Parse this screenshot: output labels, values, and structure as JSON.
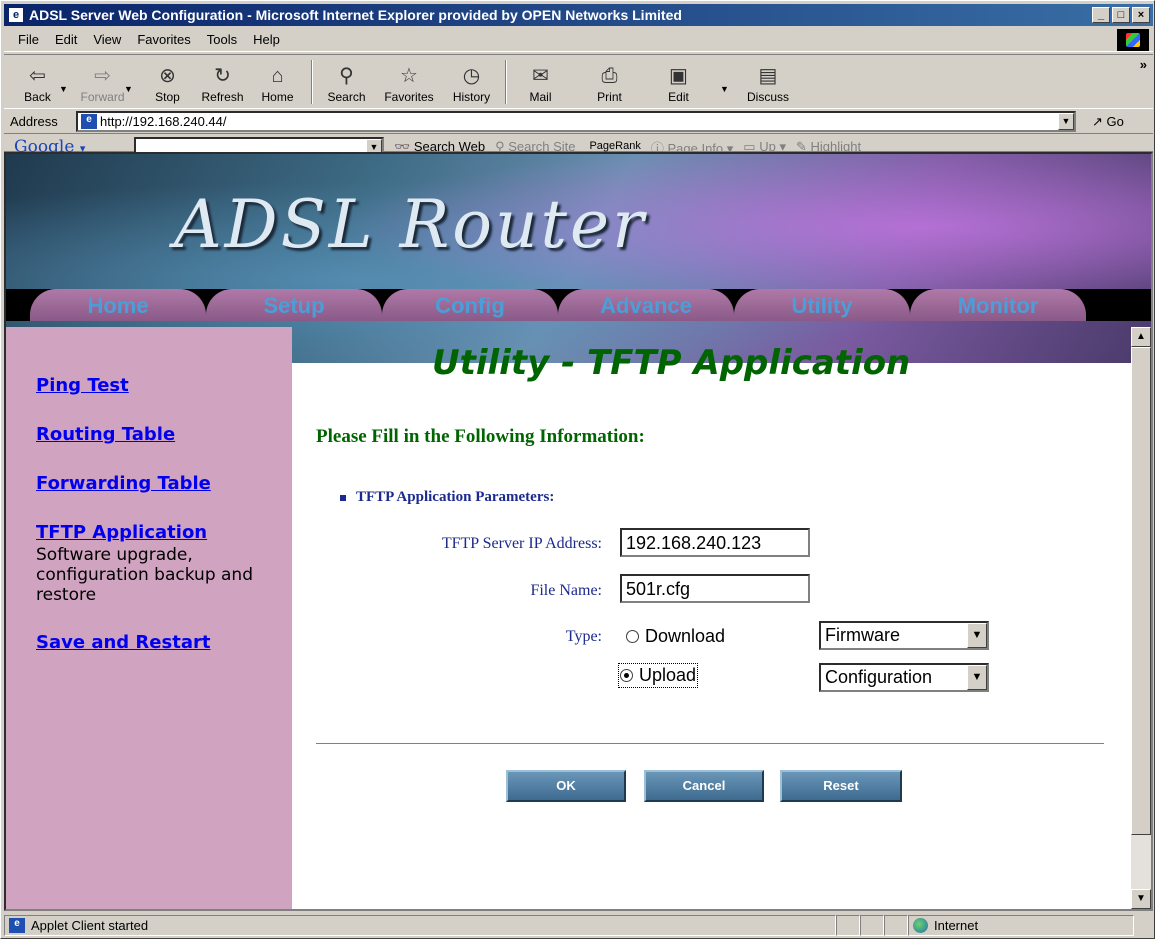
{
  "window": {
    "title": "ADSL Server Web Configuration - Microsoft Internet Explorer provided by OPEN Networks Limited",
    "app_icon": "e",
    "minimize": "_",
    "maximize": "□",
    "close": "×"
  },
  "menu": [
    "File",
    "Edit",
    "View",
    "Favorites",
    "Tools",
    "Help"
  ],
  "toolbar": {
    "back": "Back",
    "forward": "Forward",
    "stop": "Stop",
    "refresh": "Refresh",
    "home": "Home",
    "search": "Search",
    "favorites": "Favorites",
    "history": "History",
    "mail": "Mail",
    "print": "Print",
    "edit": "Edit",
    "discuss": "Discuss",
    "more": "»"
  },
  "address": {
    "label": "Address",
    "url": "http://192.168.240.44/",
    "go": "Go"
  },
  "google_bar": {
    "logo": "Google",
    "search_web": "Search Web",
    "search_site": "Search Site",
    "pagerank": "PageRank",
    "page_info": "Page Info",
    "up": "Up",
    "highlight": "Highlight"
  },
  "banner": {
    "title": "ADSL Router"
  },
  "tabs": [
    "Home",
    "Setup",
    "Config",
    "Advance",
    "Utility",
    "Monitor"
  ],
  "sidebar": {
    "items": [
      {
        "label": "Ping Test"
      },
      {
        "label": "Routing Table"
      },
      {
        "label": "Forwarding Table"
      },
      {
        "label": "TFTP Application",
        "description": "Software upgrade, configuration backup and restore"
      },
      {
        "label": "Save and Restart"
      }
    ]
  },
  "main": {
    "title": "Utility - TFTP Application",
    "instruction": "Please Fill in the Following Information:",
    "section": "TFTP Application Parameters:",
    "server_ip_label": "TFTP Server IP Address:",
    "server_ip_value": "192.168.240.123",
    "file_name_label": "File Name:",
    "file_name_value": "501r.cfg",
    "type_label": "Type:",
    "download_label": "Download",
    "upload_label": "Upload",
    "download_select": "Firmware",
    "upload_select": "Configuration",
    "selected_type": "Upload"
  },
  "actions": {
    "ok": "OK",
    "cancel": "Cancel",
    "reset": "Reset"
  },
  "status": {
    "message": "Applet Client started",
    "zone": "Internet"
  },
  "colors": {
    "title_green": "#006400",
    "link_blue": "#0000ee",
    "sidebar_bg": "#d0a4c0",
    "label_navy": "#1c2a8e"
  }
}
